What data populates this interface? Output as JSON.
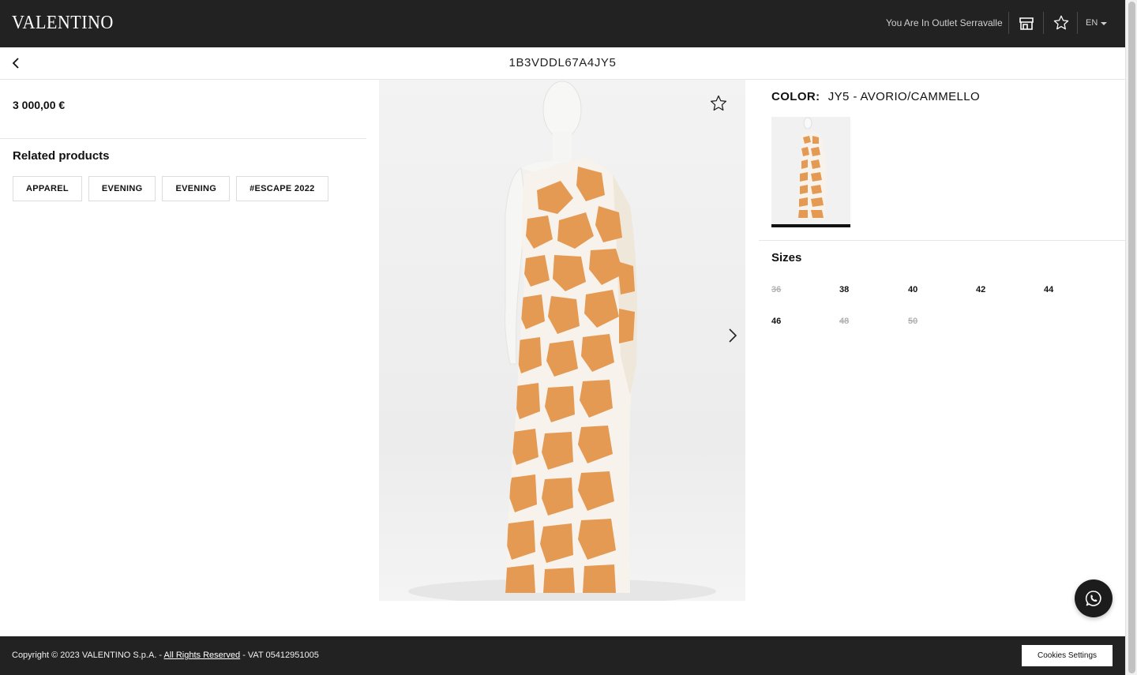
{
  "header": {
    "logo": "VALENTINO",
    "outlet_text": "You Are In Outlet Serravalle",
    "language": "EN",
    "icons": [
      "store-icon",
      "star-icon",
      "chevron-down-icon"
    ]
  },
  "subheader": {
    "sku": "1B3VDDL67A4JY5",
    "back_icon": "chevron-left-icon"
  },
  "product": {
    "price": "3 000,00 €",
    "related_title": "Related products",
    "related_tags": [
      "APPAREL",
      "EVENING",
      "EVENING",
      "#ESCAPE 2022"
    ],
    "color_label": "COLOR:",
    "color_value": "JY5 - AVORIO/CAMMELLO",
    "sizes_title": "Sizes",
    "sizes": [
      {
        "label": "36",
        "available": false
      },
      {
        "label": "38",
        "available": true
      },
      {
        "label": "40",
        "available": true
      },
      {
        "label": "42",
        "available": true
      },
      {
        "label": "44",
        "available": true
      },
      {
        "label": "46",
        "available": true
      },
      {
        "label": "48",
        "available": false
      },
      {
        "label": "50",
        "available": false
      }
    ],
    "image_icons": [
      "star-icon",
      "chevron-right-icon"
    ],
    "print_colors": {
      "base": "#f7f3ec",
      "spots": "#e59a54"
    }
  },
  "footer": {
    "copyright_prefix": "Copyright © 2023 VALENTINO S.p.A. - ",
    "rights_link": "All Rights Reserved",
    "vat": " - VAT 05412951005",
    "cookies_button": "Cookies Settings"
  },
  "chat": {
    "icon": "whatsapp-icon"
  }
}
